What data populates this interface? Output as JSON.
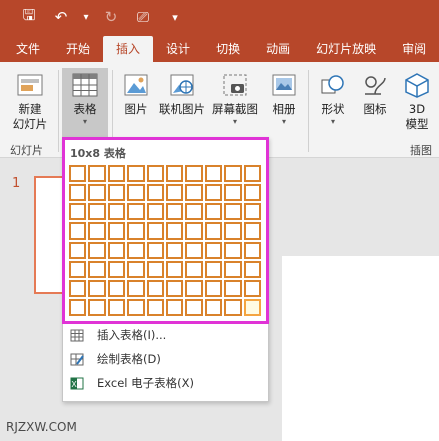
{
  "quick_access": {
    "items": [
      {
        "icon": "save-icon",
        "glyph": "🖫"
      },
      {
        "icon": "undo-icon",
        "glyph": "↶"
      },
      {
        "icon": "dropdown-arrow-icon",
        "glyph": "▾"
      },
      {
        "icon": "redo-icon",
        "glyph": "↻"
      },
      {
        "icon": "slideshow-from-start-icon",
        "glyph": "⎚"
      },
      {
        "icon": "customize-quick-access-icon",
        "glyph": "▾"
      }
    ]
  },
  "tabs": [
    {
      "label": "文件"
    },
    {
      "label": "开始"
    },
    {
      "label": "插入",
      "active": true
    },
    {
      "label": "设计"
    },
    {
      "label": "切换"
    },
    {
      "label": "动画"
    },
    {
      "label": "幻灯片放映"
    },
    {
      "label": "审阅"
    }
  ],
  "ribbon": {
    "new_slide": {
      "line1": "新建",
      "line2": "幻灯片"
    },
    "table": {
      "label": "表格"
    },
    "picture": {
      "label": "图片"
    },
    "online_picture": {
      "label": "联机图片"
    },
    "screenshot": {
      "label": "屏幕截图"
    },
    "album": {
      "label": "相册"
    },
    "shapes": {
      "label": "形状"
    },
    "icons": {
      "label": "图标"
    },
    "model3d": {
      "line1": "3D",
      "line2": "模型"
    },
    "groups": {
      "slides": "幻灯片",
      "illustrations": "插图"
    }
  },
  "slides_pane": {
    "slide_number": "1"
  },
  "table_dropdown": {
    "grid_title": "10x8 表格",
    "columns": 10,
    "rows": 8,
    "menu": [
      {
        "label": "插入表格(I)...",
        "icon": "insert-table-icon"
      },
      {
        "label": "绘制表格(D)",
        "icon": "draw-table-icon"
      },
      {
        "label": "Excel 电子表格(X)",
        "icon": "excel-spreadsheet-icon"
      }
    ]
  },
  "watermark": "RJZXW.COM",
  "colors": {
    "accent": "#b7472a",
    "grid_border": "#d9822b",
    "highlight": "#e033d6"
  }
}
